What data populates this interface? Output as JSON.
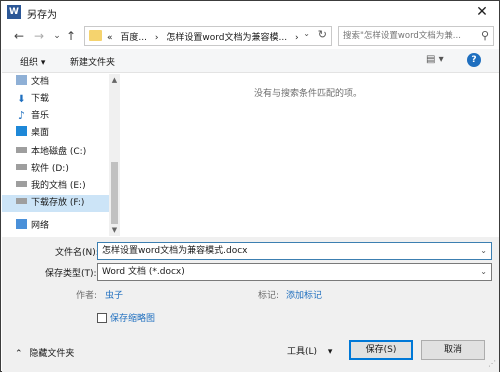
{
  "window": {
    "title": "另存为",
    "app_icon": "W",
    "close_glyph": "✕"
  },
  "address": {
    "crumbs": [
      "«",
      "百度...",
      "›",
      "怎样设置word文档为兼容模...",
      "›"
    ],
    "search_placeholder": "搜索\"怎样设置word文档为兼...",
    "back_glyph": "←",
    "forward_glyph": "→",
    "dropdown_glyph": "⌄",
    "up_glyph": "↑",
    "address_dropdown_glyph": "⌄",
    "refresh_glyph": "↻",
    "search_glyph": "⚲"
  },
  "toolbar": {
    "organize": "组织 ▾",
    "new_folder": "新建文件夹",
    "view_glyph": "▤ ▾",
    "help_glyph": "?"
  },
  "nav": {
    "items": [
      {
        "label": "文档",
        "icon": "documents-icon"
      },
      {
        "label": "下载",
        "icon": "downloads-icon"
      },
      {
        "label": "音乐",
        "icon": "music-icon"
      },
      {
        "label": "桌面",
        "icon": "desktop-icon"
      },
      {
        "label": "本地磁盘 (C:)",
        "icon": "drive-icon"
      },
      {
        "label": "软件 (D:)",
        "icon": "drive-icon"
      },
      {
        "label": "我的文档 (E:)",
        "icon": "drive-icon"
      },
      {
        "label": "下载存放 (F:)",
        "icon": "drive-icon",
        "selected": true
      },
      {
        "label": "网络",
        "icon": "network-icon"
      }
    ],
    "scroll_up_glyph": "▲",
    "scroll_down_glyph": "▼"
  },
  "main": {
    "empty_message": "没有与搜索条件匹配的项。"
  },
  "form": {
    "filename_label": "文件名(N):",
    "filename_value": "怎样设置word文档为兼容模式.docx",
    "filetype_label": "保存类型(T):",
    "filetype_value": "Word 文档 (*.docx)",
    "author_label": "作者:",
    "author_value": "虫子",
    "tags_label": "标记:",
    "tags_value": "添加标记",
    "thumbnail_label": "保存缩略图",
    "dropdown_glyph": "⌄"
  },
  "footer": {
    "hide_folders": "隐藏文件夹",
    "hide_folders_glyph": "⌃",
    "tools": "工具(L)",
    "tools_glyph": "▾",
    "save": "保存(S)",
    "cancel": "取消"
  },
  "colors": {
    "accent": "#0078d7",
    "link": "#1f6fbf",
    "selection": "#cce4f7"
  }
}
